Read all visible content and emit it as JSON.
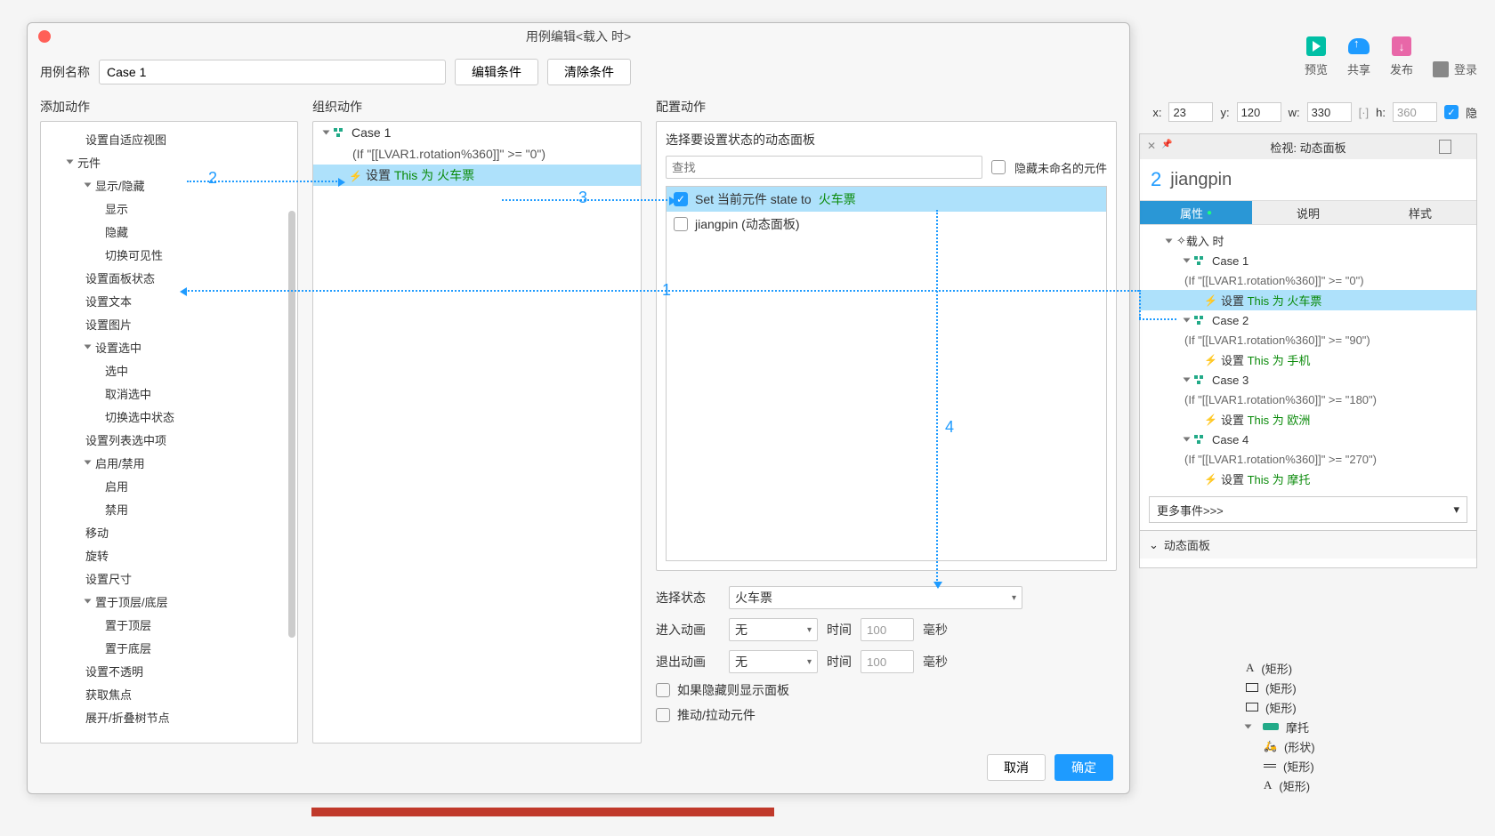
{
  "dialog": {
    "title": "用例编辑<载入 时>",
    "caseNameLabel": "用例名称",
    "caseName": "Case 1",
    "editCondBtn": "编辑条件",
    "clearCondBtn": "清除条件",
    "columns": {
      "add": "添加动作",
      "organize": "组织动作",
      "configure": "配置动作"
    },
    "footer": {
      "cancel": "取消",
      "ok": "确定"
    }
  },
  "addActions": {
    "adaptive": "设置自适应视图",
    "widgets": "元件",
    "showHide": "显示/隐藏",
    "show": "显示",
    "hide": "隐藏",
    "toggleVis": "切换可见性",
    "setPanelState": "设置面板状态",
    "setText": "设置文本",
    "setImage": "设置图片",
    "setSelected": "设置选中",
    "select": "选中",
    "deselect": "取消选中",
    "toggleSel": "切换选中状态",
    "setListSel": "设置列表选中项",
    "enableDisable": "启用/禁用",
    "enable": "启用",
    "disable": "禁用",
    "move": "移动",
    "rotate": "旋转",
    "setSize": "设置尺寸",
    "bringFrontBack": "置于顶层/底层",
    "bringFront": "置于顶层",
    "sendBack": "置于底层",
    "setOpacity": "设置不透明",
    "focus": "获取焦点",
    "expandCollapse": "展开/折叠树节点"
  },
  "organize": {
    "case": "Case 1",
    "cond": "(If \"[[LVAR1.rotation%360]]\" >= \"0\")",
    "actionPrefix": "设置",
    "actionGreen": "This 为 火车票"
  },
  "configure": {
    "title": "选择要设置状态的动态面板",
    "searchPlaceholder": "查找",
    "hideUnnamed": "隐藏未命名的元件",
    "setPrefix": "Set 当前元件 state to",
    "setGreen": "火车票",
    "secondRow": "jiangpin (动态面板)",
    "selectState": "选择状态",
    "selectStateVal": "火车票",
    "animIn": "进入动画",
    "animOut": "退出动画",
    "none": "无",
    "time": "时间",
    "timeVal": "100",
    "ms": "毫秒",
    "showIfHidden": "如果隐藏则显示面板",
    "pushPull": "推动/拉动元件"
  },
  "toolbar": {
    "preview": "预览",
    "share": "共享",
    "publish": "发布",
    "login": "登录"
  },
  "position": {
    "xlabel": "x:",
    "x": "23",
    "ylabel": "y:",
    "y": "120",
    "wlabel": "w:",
    "w": "330",
    "hlabel": "h:",
    "h": "360",
    "hiddenLabel": "隐"
  },
  "inspector": {
    "title": "检视: 动态面板",
    "num": "2",
    "name": "jiangpin",
    "tabProps": "属性",
    "tabNotes": "说明",
    "tabStyle": "样式",
    "onLoad": "载入 时",
    "cases": [
      {
        "name": "Case 1",
        "cond": "(If \"[[LVAR1.rotation%360]]\" >= \"0\")",
        "set": "设置",
        "green": "This 为 火车票"
      },
      {
        "name": "Case 2",
        "cond": "(If \"[[LVAR1.rotation%360]]\" >= \"90\")",
        "set": "设置",
        "green": "This 为 手机"
      },
      {
        "name": "Case 3",
        "cond": "(If \"[[LVAR1.rotation%360]]\" >= \"180\")",
        "set": "设置",
        "green": "This 为 欧洲"
      },
      {
        "name": "Case 4",
        "cond": "(If \"[[LVAR1.rotation%360]]\" >= \"270\")",
        "set": "设置",
        "green": "This 为 摩托"
      }
    ],
    "moreEvents": "更多事件>>>",
    "sectionDP": "动态面板"
  },
  "outline": {
    "rect1": "(矩形)",
    "rect2": "(矩形)",
    "rect3": "(矩形)",
    "moto": "摩托",
    "shape": "(形状)",
    "rect4": "(矩形)",
    "rect5": "(矩形)"
  },
  "ann": {
    "n1": "1",
    "n2": "2",
    "n3": "3",
    "n4": "4"
  }
}
